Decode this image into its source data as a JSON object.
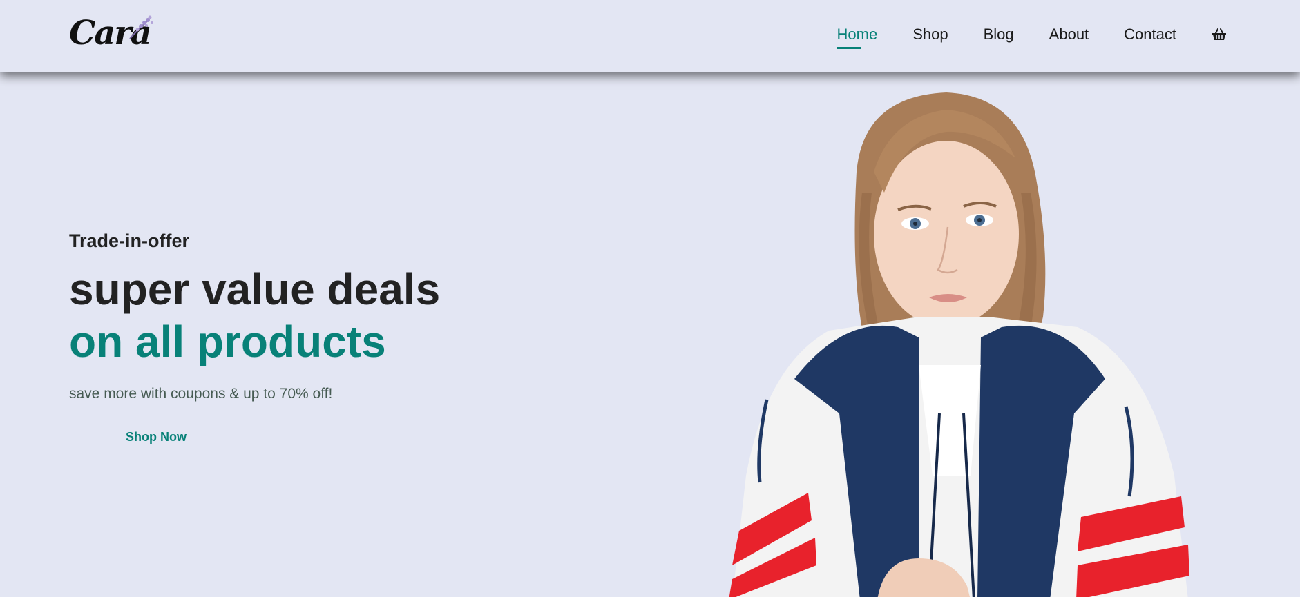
{
  "brand": {
    "logo_text": "Cara"
  },
  "nav": {
    "items": [
      {
        "label": "Home",
        "active": true
      },
      {
        "label": "Shop",
        "active": false
      },
      {
        "label": "Blog",
        "active": false
      },
      {
        "label": "About",
        "active": false
      },
      {
        "label": "Contact",
        "active": false
      }
    ],
    "cart_icon": "shopping-basket-icon"
  },
  "hero": {
    "eyebrow": "Trade-in-offer",
    "headline_1": "super value deals",
    "headline_2": "on all products",
    "subtext": "save more with coupons & up to 70% off!",
    "cta_label": "Shop Now"
  },
  "colors": {
    "background": "#e3e6f3",
    "accent": "#088178",
    "text_dark": "#222222"
  }
}
